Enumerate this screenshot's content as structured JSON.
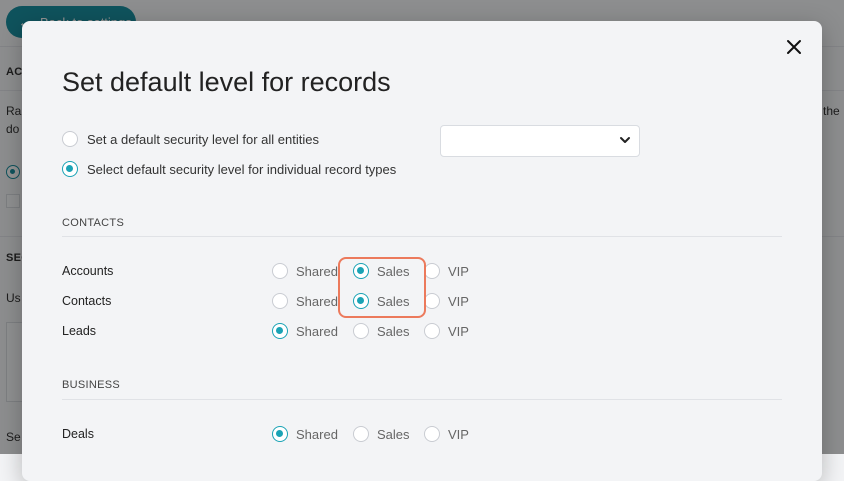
{
  "background": {
    "back_button": "Back to settings",
    "section_1_label": "ACT",
    "line_1_start": "Ra",
    "line_1_end": "the",
    "line_2_start": "do",
    "section_2_label": "SEC",
    "line_3_start": "Us",
    "line_4_start": "Se"
  },
  "modal": {
    "title": "Set default level for records",
    "options": [
      {
        "label": "Set a default security level for all entities",
        "selected": false
      },
      {
        "label": "Select default security level for individual record types",
        "selected": true
      }
    ],
    "dropdown_value": "",
    "levels": [
      "Shared",
      "Sales",
      "VIP"
    ],
    "sections": [
      {
        "label": "CONTACTS",
        "records": [
          {
            "name": "Accounts",
            "selected": "Sales"
          },
          {
            "name": "Contacts",
            "selected": "Sales"
          },
          {
            "name": "Leads",
            "selected": "Shared"
          }
        ]
      },
      {
        "label": "BUSINESS",
        "records": [
          {
            "name": "Deals",
            "selected": "Shared"
          }
        ]
      }
    ]
  },
  "colors": {
    "accent": "#1aa3b5",
    "highlight": "#ec7a5c",
    "back_button": "#1b8fa0"
  },
  "icons": {
    "close": "close-icon",
    "dropdown": "chevron-down-icon",
    "back": "arrow-left-icon"
  }
}
